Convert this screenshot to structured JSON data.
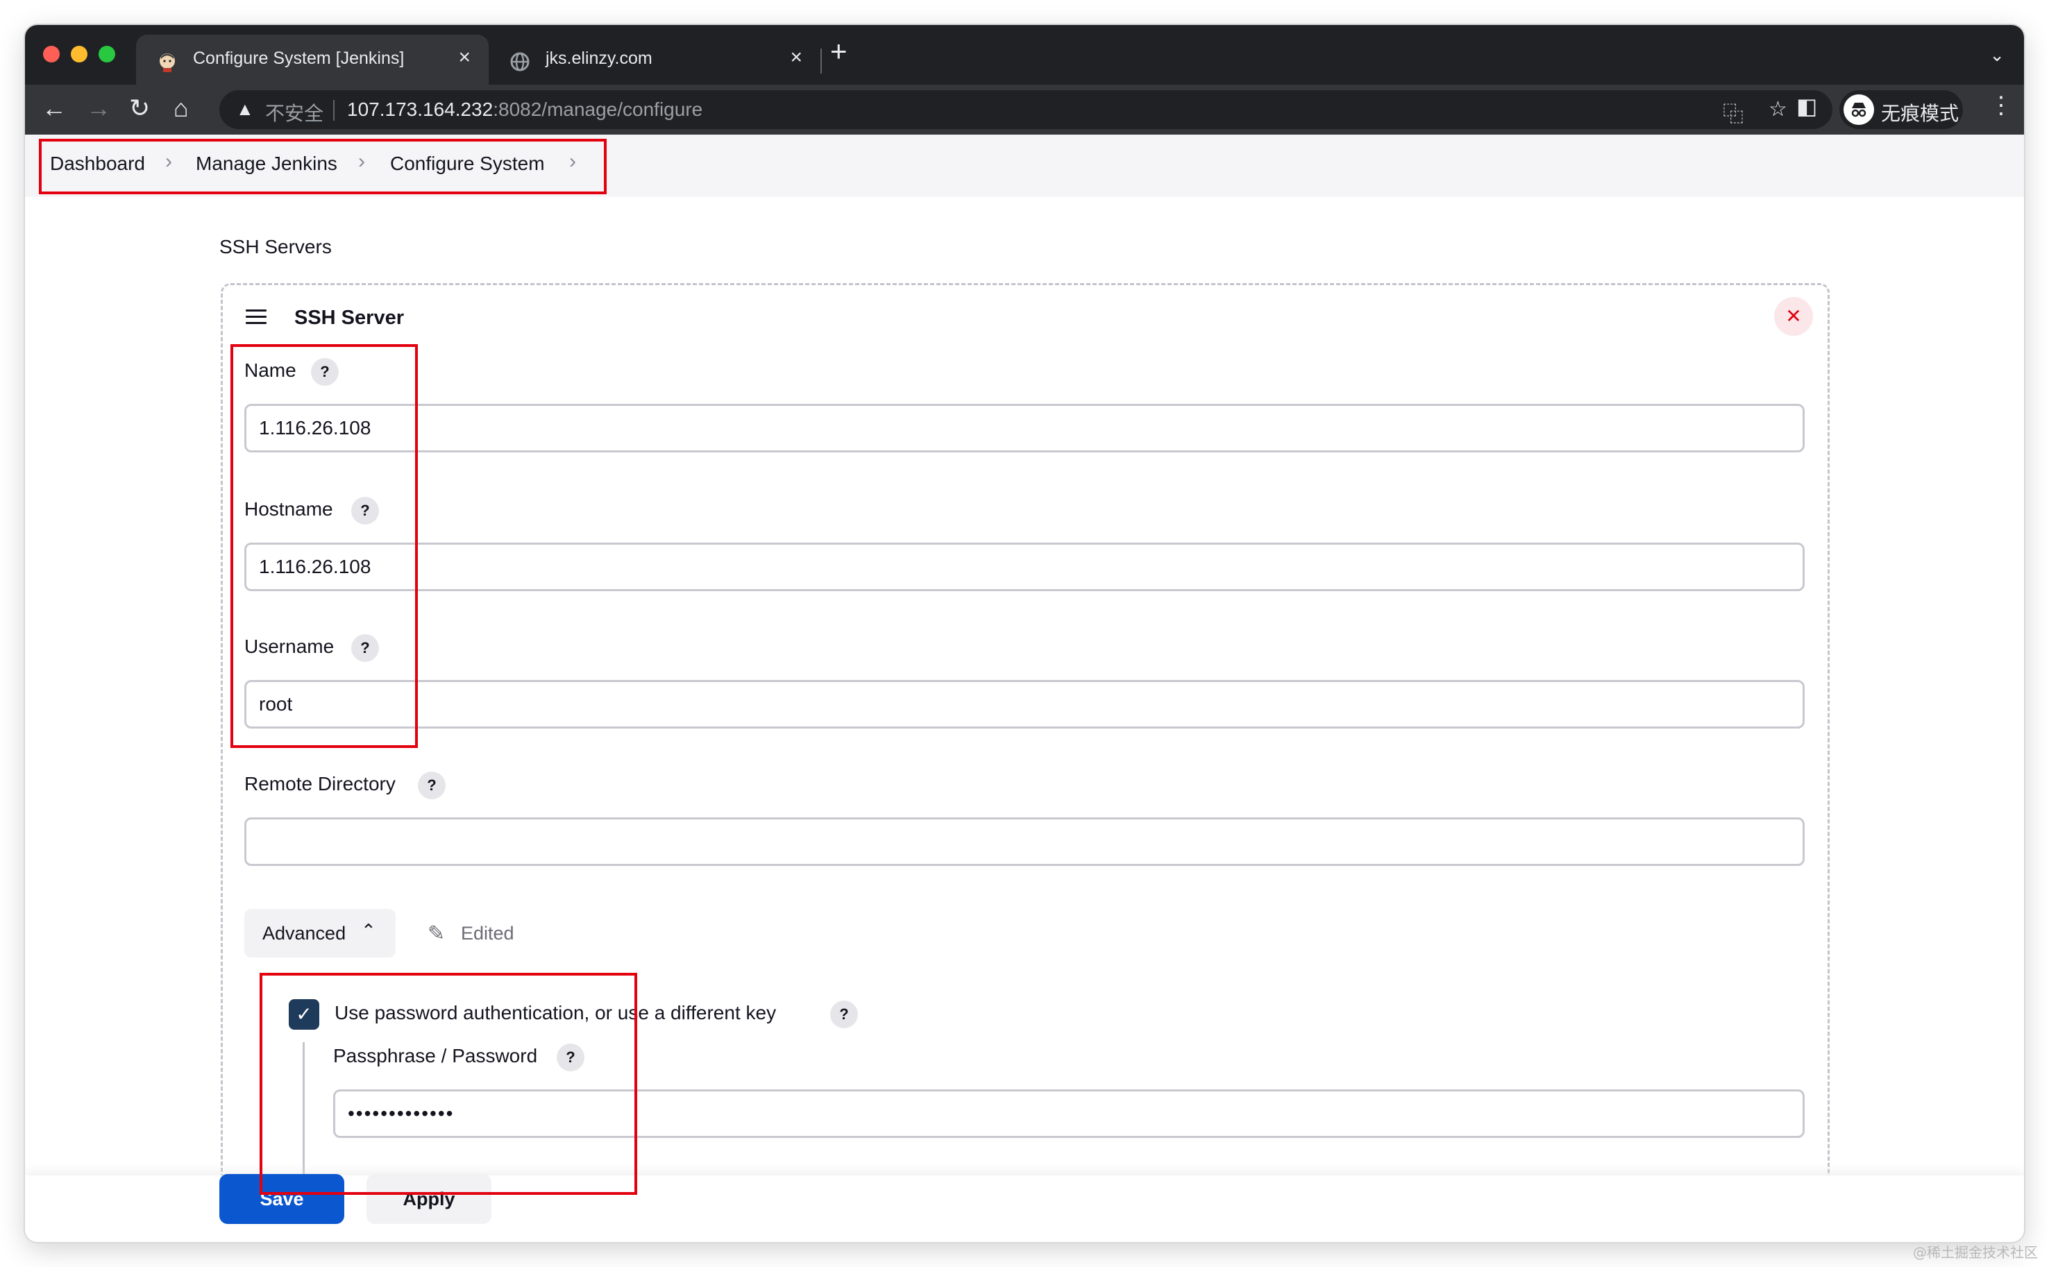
{
  "browser": {
    "tabs": [
      {
        "title": "Configure System [Jenkins]",
        "active": true,
        "icon": "jenkins-butler-icon"
      },
      {
        "title": "jks.elinzy.com",
        "active": false,
        "icon": "globe-icon"
      }
    ],
    "address": {
      "security_label": "不安全",
      "host": "107.173.164.232",
      "path": ":8082/manage/configure"
    },
    "profile_label": "无痕模式"
  },
  "breadcrumb": {
    "items": [
      "Dashboard",
      "Manage Jenkins",
      "Configure System"
    ]
  },
  "section_title": "SSH Servers",
  "ssh_server": {
    "title": "SSH Server",
    "fields": {
      "name": {
        "label": "Name",
        "value": "1.116.26.108"
      },
      "hostname": {
        "label": "Hostname",
        "value": "1.116.26.108"
      },
      "username": {
        "label": "Username",
        "value": "root"
      },
      "remote_directory": {
        "label": "Remote Directory",
        "value": ""
      }
    },
    "advanced_label": "Advanced",
    "edited_label": "Edited",
    "password_auth": {
      "label": "Use password authentication, or use a different key",
      "checked": true
    },
    "passphrase": {
      "label": "Passphrase / Password",
      "value": "•••••••••••••"
    },
    "help_glyph": "?"
  },
  "actions": {
    "save_label": "Save",
    "apply_label": "Apply"
  },
  "watermark": "@稀土掘金技术社区",
  "colors": {
    "accent_blue": "#0b57d0",
    "highlight_red": "#e3000f",
    "checkbox_navy": "#1f3b5b"
  }
}
